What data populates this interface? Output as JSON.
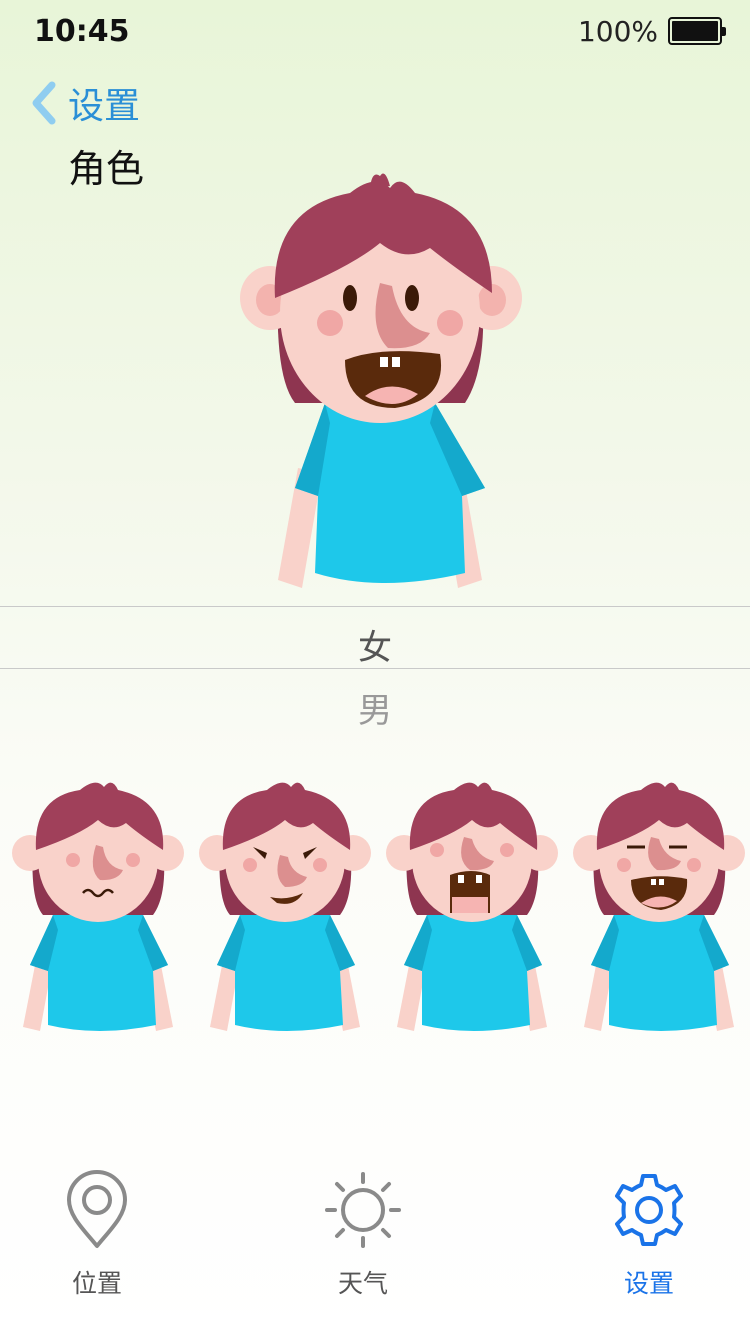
{
  "status_bar": {
    "time": "10:45",
    "battery_percent": "100%",
    "battery_level": 1.0
  },
  "nav": {
    "back_label": "设置",
    "title": "角色"
  },
  "gender_picker": {
    "selected": "女",
    "other": "男"
  },
  "character": {
    "hair_color": "#a0405a",
    "skin_color": "#f9d2ca",
    "shirt_color": "#1ec8ea",
    "mouth_color": "#5a2a0c"
  },
  "tabs": [
    {
      "label": "位置",
      "icon": "location-pin-icon",
      "active": false
    },
    {
      "label": "天气",
      "icon": "sun-icon",
      "active": false
    },
    {
      "label": "设置",
      "icon": "gear-icon",
      "active": true
    }
  ],
  "colors": {
    "accent": "#1a73e8",
    "back_link": "#2a8fd6",
    "inactive_icon": "#8a8a8a"
  }
}
